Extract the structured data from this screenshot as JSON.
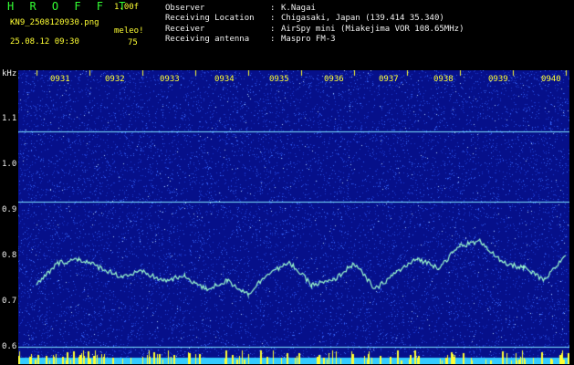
{
  "header": {
    "app_title": "H R O F F T",
    "version": "1.00f",
    "file_name": "KN9_2508120930.png",
    "param_name": "meleo!",
    "param_value": "75",
    "datetime": "25.08.12 09:30"
  },
  "info": [
    {
      "key": "Observer",
      "value": "K.Nagai"
    },
    {
      "key": "Receiving Location",
      "value": "Chigasaki, Japan (139.414 35.340)"
    },
    {
      "key": "Receiver",
      "value": "AirSpy mini (Miakejima VOR 108.65MHz)"
    },
    {
      "key": "Receiving antenna",
      "value": "Maspro FM-3"
    }
  ],
  "axis": {
    "y_unit": "kHz",
    "y_ticks": [
      "1.1",
      "1.0",
      "0.9",
      "0.8",
      "0.7",
      "0.6"
    ],
    "x_ticks": [
      "0931",
      "0932",
      "0933",
      "0934",
      "0935",
      "0936",
      "0937",
      "0938",
      "0939",
      "0940"
    ]
  },
  "colors": {
    "background": "#06108a",
    "noise": "#3a6cff",
    "trace": "#9effd0",
    "marker": "#ffff33",
    "baseline": "#33ccff"
  },
  "chart_data": {
    "type": "line",
    "title": "",
    "xlabel": "",
    "ylabel": "kHz",
    "ylim": [
      0.58,
      1.25
    ],
    "x": [
      0,
      0.4,
      0.8,
      1.2,
      1.6,
      2.0,
      2.4,
      2.8,
      3.2,
      3.6,
      4.0,
      4.4,
      4.8,
      5.2,
      5.6,
      6.0,
      6.4,
      6.8,
      7.2,
      7.6,
      8.0,
      8.4,
      8.8,
      9.2,
      9.6,
      10.0
    ],
    "series": [
      {
        "values": [
          0.76,
          0.81,
          0.82,
          0.8,
          0.78,
          0.79,
          0.77,
          0.78,
          0.75,
          0.77,
          0.74,
          0.79,
          0.81,
          0.76,
          0.77,
          0.81,
          0.75,
          0.79,
          0.82,
          0.8,
          0.85,
          0.86,
          0.81,
          0.8,
          0.77,
          0.83
        ]
      },
      {
        "values": [
          1.11,
          1.11,
          1.11,
          1.11,
          1.11,
          1.11,
          1.11,
          1.11,
          1.11,
          1.11,
          1.11,
          1.11,
          1.11,
          1.11,
          1.11,
          1.11,
          1.11,
          1.11,
          1.11,
          1.11,
          1.11,
          1.11,
          1.11,
          1.11,
          1.11,
          1.11
        ]
      },
      {
        "values": [
          0.95,
          0.95,
          0.95,
          0.95,
          0.95,
          0.95,
          0.95,
          0.95,
          0.95,
          0.95,
          0.95,
          0.95,
          0.95,
          0.95,
          0.95,
          0.95,
          0.95,
          0.95,
          0.95,
          0.95,
          0.95,
          0.95,
          0.95,
          0.95,
          0.95,
          0.95
        ]
      },
      {
        "values": [
          0.62,
          0.62,
          0.62,
          0.62,
          0.62,
          0.62,
          0.62,
          0.62,
          0.62,
          0.62,
          0.62,
          0.62,
          0.62,
          0.62,
          0.62,
          0.62,
          0.62,
          0.62,
          0.62,
          0.62,
          0.62,
          0.62,
          0.62,
          0.62,
          0.62,
          0.62
        ]
      }
    ]
  }
}
